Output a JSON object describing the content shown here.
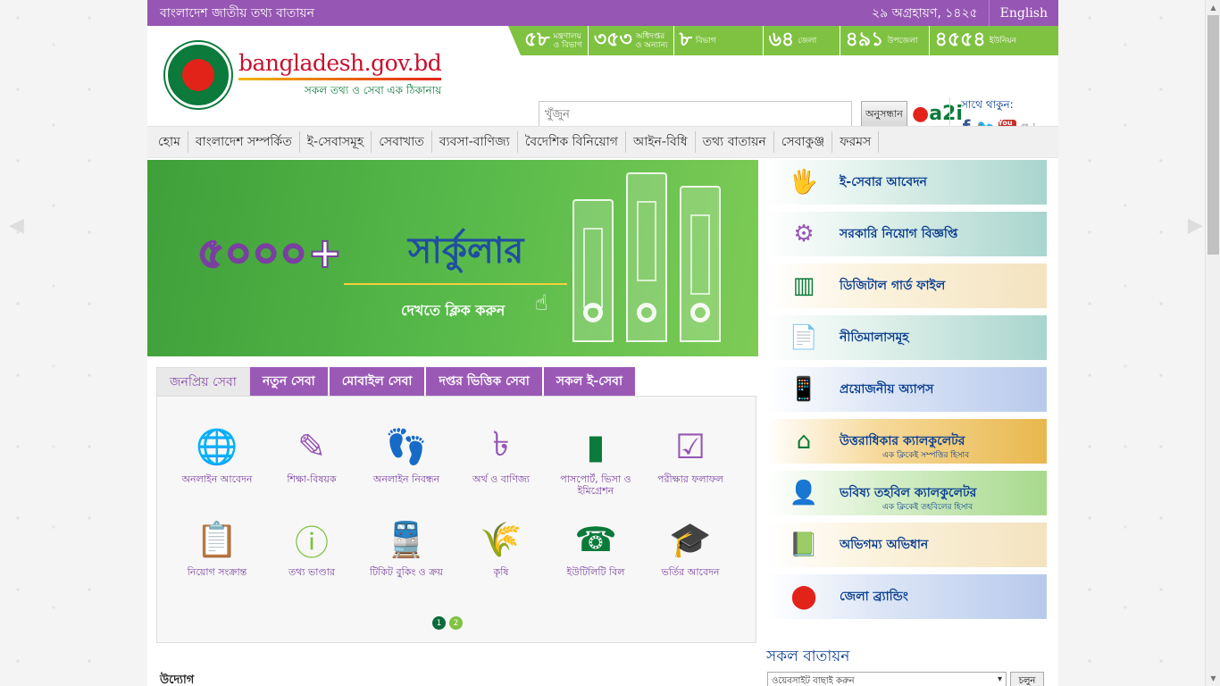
{
  "topbar": {
    "site_name": "বাংলাদেশ জাতীয় তথ্য বাতায়ন",
    "date": "২৯ অগ্রহায়ণ, ১৪২৫",
    "lang": "English"
  },
  "logo": {
    "title": "bangladesh.gov.bd",
    "subtitle": "সকল তথ্য ও সেবা এক ঠিকানায়"
  },
  "stats": [
    {
      "num": "৫৮",
      "label1": "মন্ত্রণালয়",
      "label2": "ও বিভাগ"
    },
    {
      "num": "৩৫৩",
      "label1": "অধিদপ্তর",
      "label2": "ও অন্যান্য"
    },
    {
      "num": "৮",
      "label1": "বিভাগ",
      "label2": ""
    },
    {
      "num": "৬৪",
      "label1": "জেলা",
      "label2": ""
    },
    {
      "num": "৪৯১",
      "label1": "উপজেলা",
      "label2": ""
    },
    {
      "num": "৪৫৫৪",
      "label1": "ইউনিয়ন",
      "label2": ""
    }
  ],
  "search": {
    "placeholder": "খুঁজুন",
    "button": "অনুসন্ধান"
  },
  "a2i": "a2i",
  "social": {
    "label": "সাথে থাকুন:",
    "youtube": "You Tube"
  },
  "nav": [
    "হোম",
    "বাংলাদেশ সম্পর্কিত",
    "ই-সেবাসমূহ",
    "সেবাখাত",
    "ব্যবসা-বাণিজ্য",
    "বৈদেশিক বিনিয়োগ",
    "আইন-বিধি",
    "তথ্য বাতায়ন",
    "সেবাকুঞ্জ",
    "ফরমস"
  ],
  "banner": {
    "number": "৫০০০+",
    "word": "সার্কুলার",
    "cta": "দেখতে ক্লিক করুন"
  },
  "tabs": [
    "জনপ্রিয় সেবা",
    "নতুন সেবা",
    "মোবাইল সেবা",
    "দপ্তর ভিত্তিক সেবা",
    "সকল ই-সেবা"
  ],
  "services": [
    {
      "icon": "globe-icon",
      "label": "অনলাইন আবেদন"
    },
    {
      "icon": "education-icon",
      "label": "শিক্ষা-বিষয়ক"
    },
    {
      "icon": "footprint-icon",
      "label": "অনলাইন নিবন্ধন"
    },
    {
      "icon": "finance-icon",
      "label": "অর্থ ও বাণিজ্য"
    },
    {
      "icon": "passport-icon",
      "label": "পাসপোর্ট, ভিসা ও ইমিগ্রেশন"
    },
    {
      "icon": "exam-result-icon",
      "label": "পরীক্ষার ফলাফল"
    },
    {
      "icon": "job-icon",
      "label": "নিয়োগ সংক্রান্ত"
    },
    {
      "icon": "info-icon",
      "label": "তথ্য ভাণ্ডার"
    },
    {
      "icon": "train-icon",
      "label": "টিকিট বুকিং ও ক্রয়"
    },
    {
      "icon": "agriculture-icon",
      "label": "কৃষি"
    },
    {
      "icon": "phone-icon",
      "label": "ইউটিলিটি বিল"
    },
    {
      "icon": "graduation-icon",
      "label": "ভর্তির আবেদন"
    }
  ],
  "pager": [
    "1",
    "2"
  ],
  "udyog": "উদ্যোগ",
  "side_links": [
    {
      "icon": "e-service-icon",
      "label": "ই-সেবার আবেদন",
      "sub": ""
    },
    {
      "icon": "recruitment-icon",
      "label": "সরকারি নিয়োগ বিজ্ঞপ্তি",
      "sub": ""
    },
    {
      "icon": "file-icon",
      "label": "ডিজিটাল গার্ড ফাইল",
      "sub": ""
    },
    {
      "icon": "policy-icon",
      "label": "নীতিমালাসমূহ",
      "sub": ""
    },
    {
      "icon": "apps-icon",
      "label": "প্রয়োজনীয় অ্যাপস",
      "sub": ""
    },
    {
      "icon": "inheritance-icon",
      "label": "উত্তরাধিকার ক্যালকুলেটর",
      "sub": "এক ক্লিকেই সম্পত্তির হিসাব"
    },
    {
      "icon": "provident-fund-icon",
      "label": "ভবিষ্য তহবিল ক্যালকুলেটর",
      "sub": "এক ক্লিকেই তহবিলের হিসাব"
    },
    {
      "icon": "dictionary-icon",
      "label": "অভিগম্য অভিধান",
      "sub": ""
    },
    {
      "icon": "district-branding-icon",
      "label": "জেলা ব্র্যান্ডিং",
      "sub": ""
    }
  ],
  "side_title": "সকল বাতায়ন",
  "site_select": "ওয়েবসাইট বাছাই করুন",
  "go_button": "চলুন",
  "colors": {
    "purple": "#9656b3",
    "green": "#7fc241",
    "blue_text": "#0b3f91"
  }
}
